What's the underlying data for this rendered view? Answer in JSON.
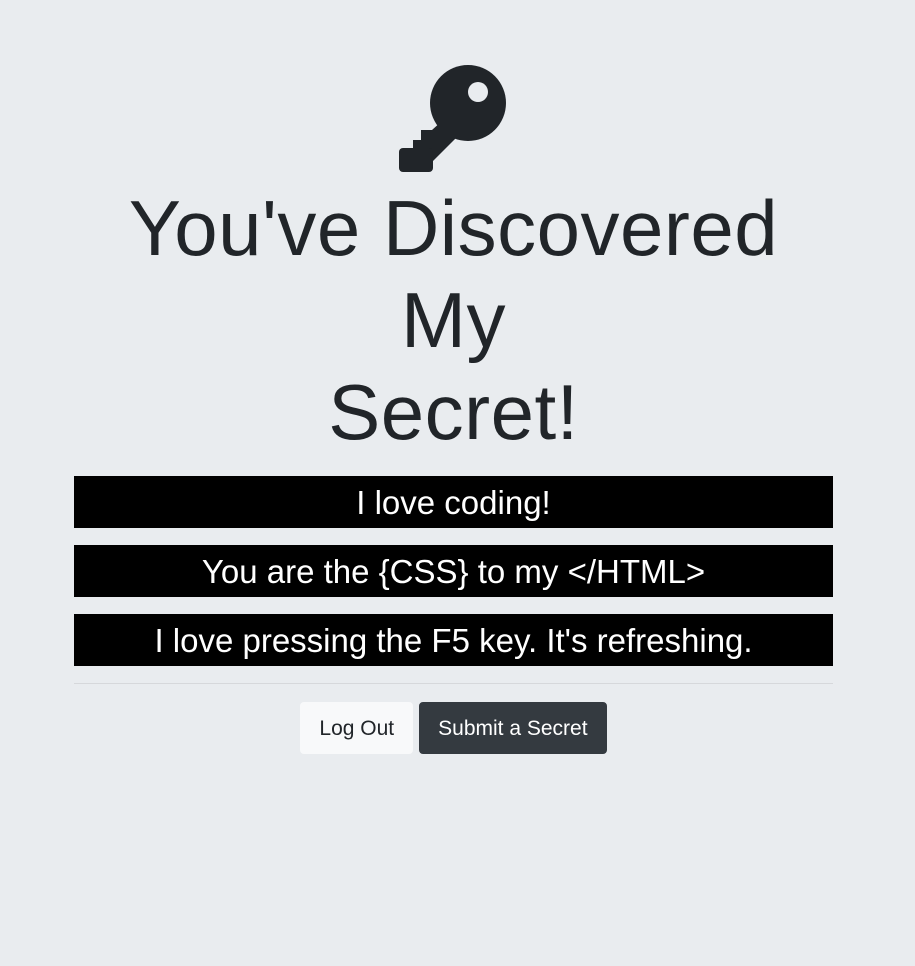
{
  "header": {
    "icon": "key-icon",
    "title_line1": "You've Discovered My",
    "title_line2": "Secret!"
  },
  "secrets": [
    "I love coding!",
    "You are the {CSS} to my </HTML>",
    "I love pressing the F5 key. It's refreshing."
  ],
  "actions": {
    "logout_label": "Log Out",
    "submit_label": "Submit a Secret"
  },
  "colors": {
    "background": "#e9ecef",
    "secret_bg": "#000000",
    "secret_text": "#ffffff",
    "dark_button": "#343a40",
    "light_button": "#f8f9fa"
  }
}
